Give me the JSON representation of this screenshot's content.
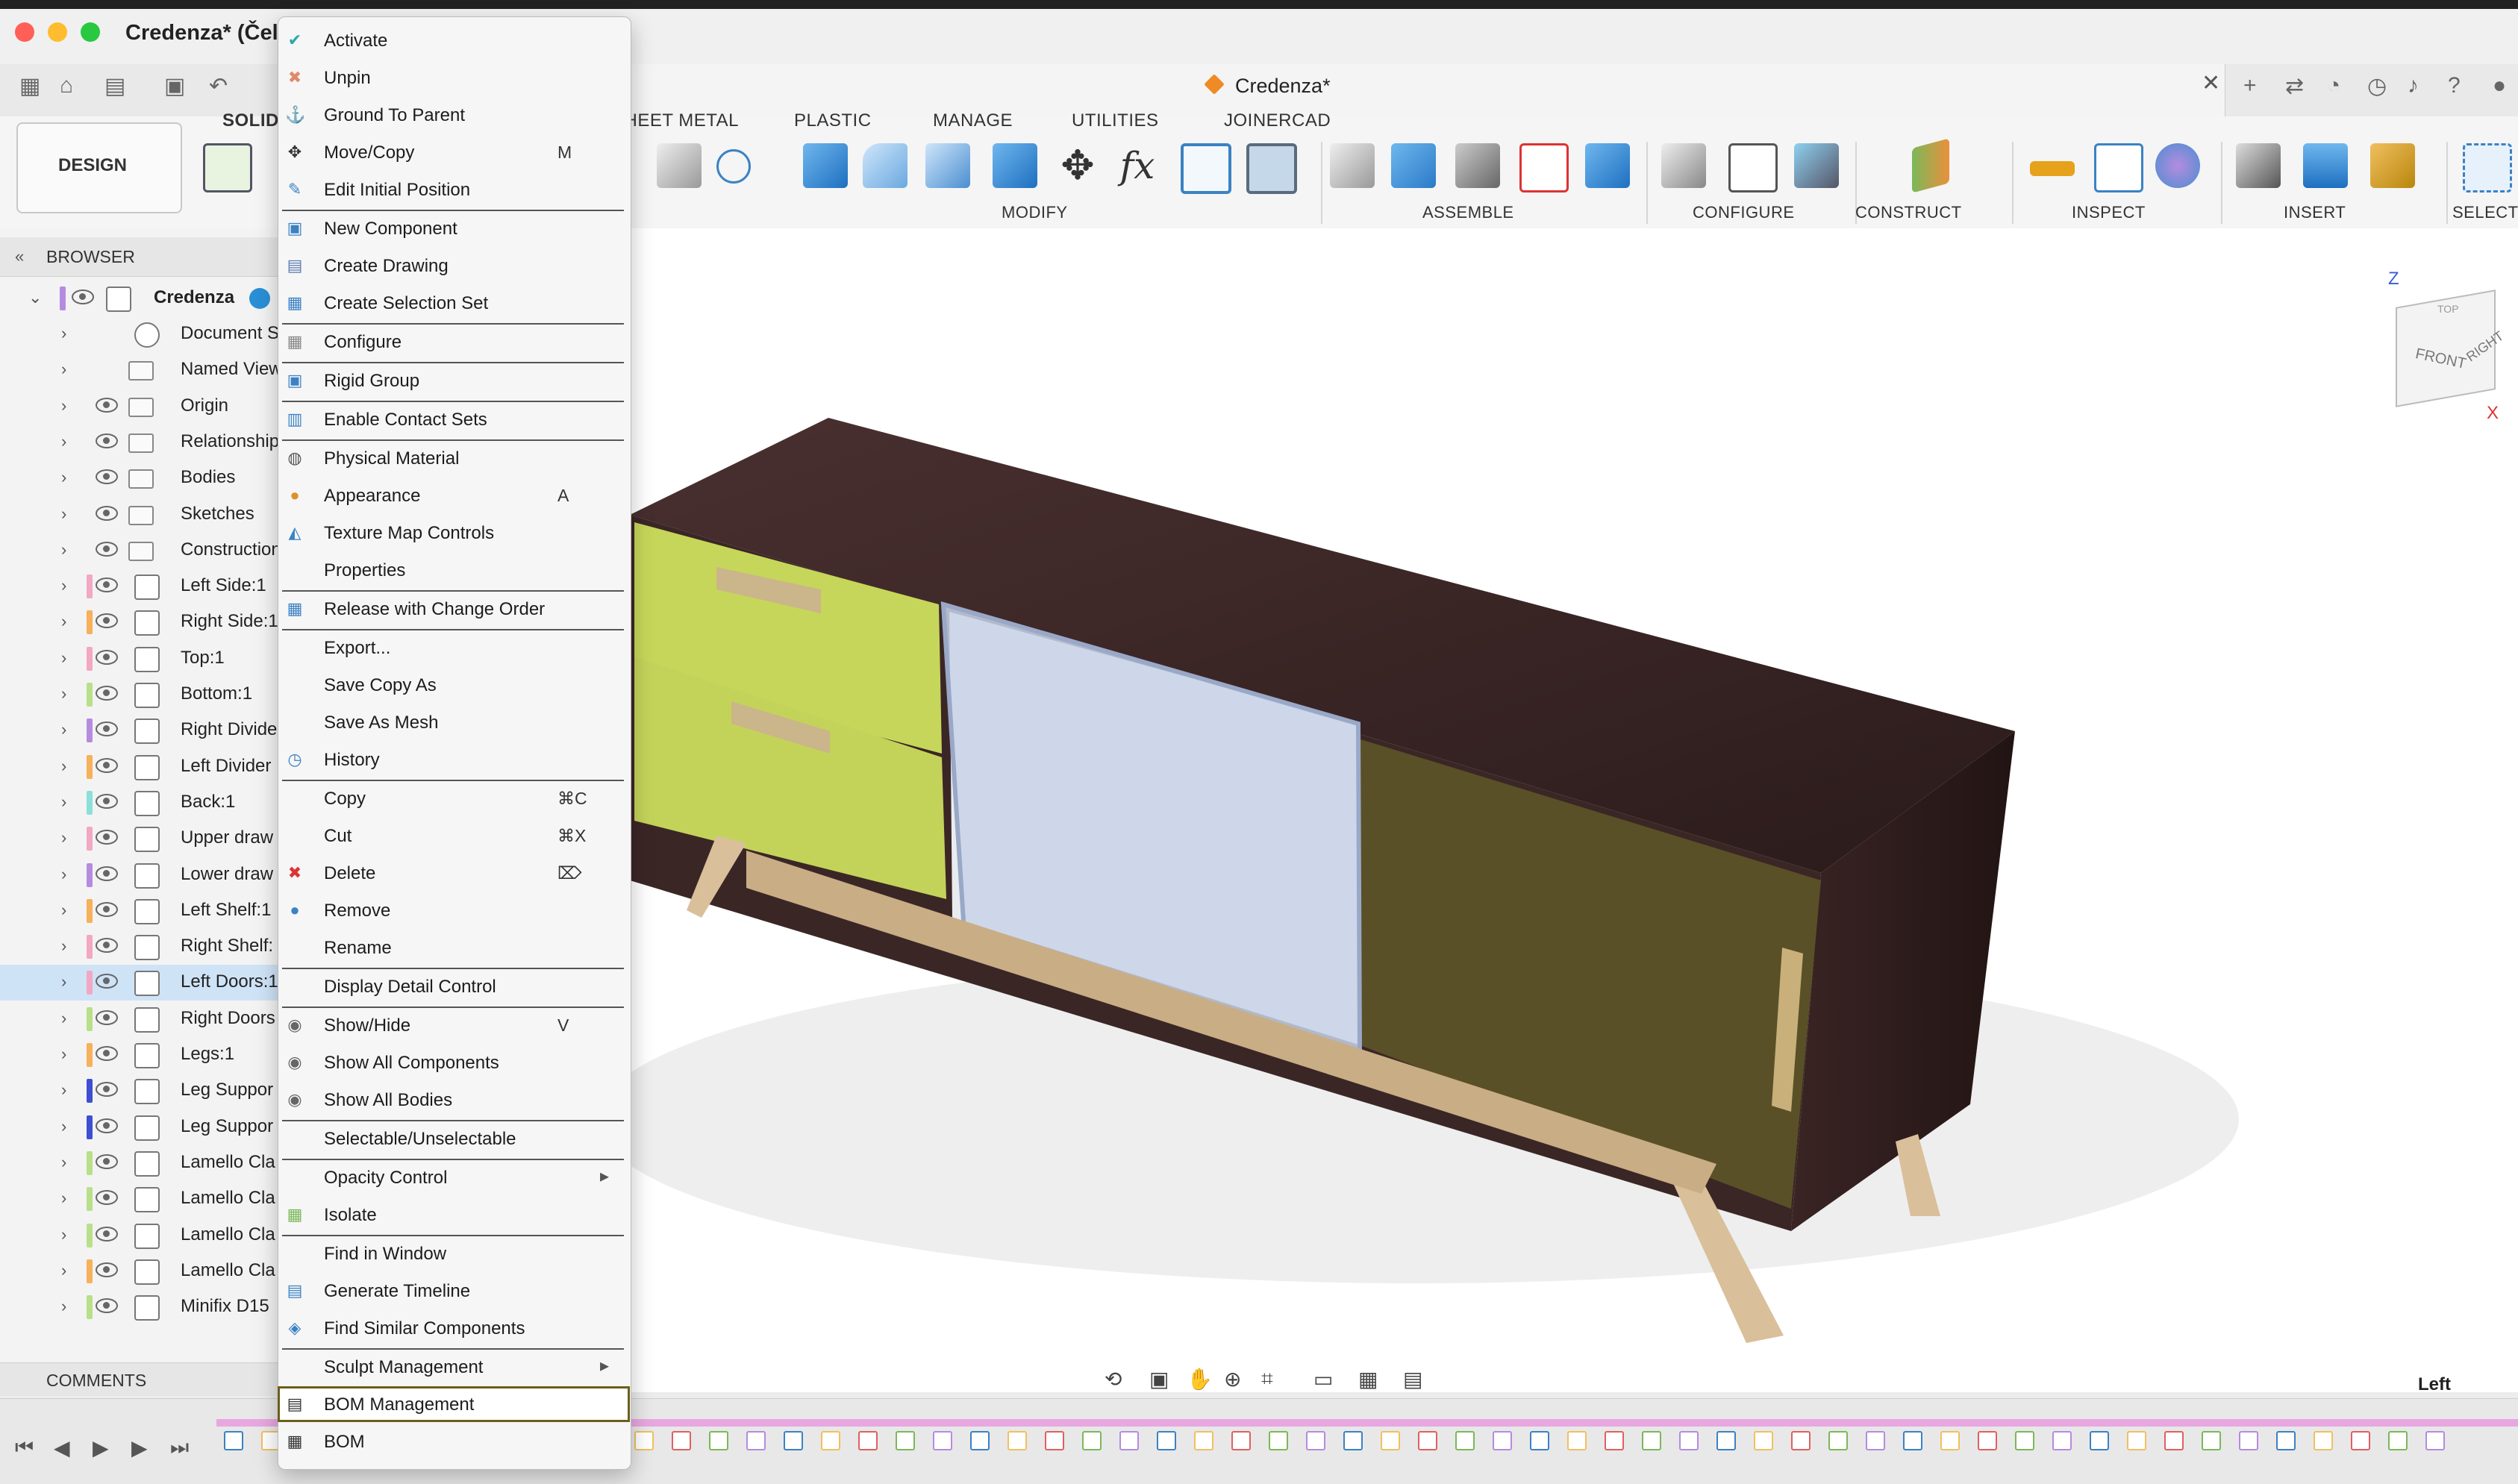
{
  "window": {
    "title": "Credenza* (Čeli",
    "document_tab": "Credenza*"
  },
  "workspace": {
    "design_button": "DESIGN",
    "tabs": [
      "SOLID",
      "SHEET METAL",
      "PLASTIC",
      "MANAGE",
      "UTILITIES",
      "JOINERCAD"
    ],
    "groups": [
      "MODIFY",
      "ASSEMBLE",
      "CONFIGURE",
      "CONSTRUCT",
      "INSPECT",
      "INSERT",
      "SELECT"
    ]
  },
  "browser": {
    "title": "BROWSER",
    "root": "Credenza",
    "items": [
      {
        "label": "Document Settin",
        "kind": "gear",
        "color": ""
      },
      {
        "label": "Named Views",
        "kind": "folder",
        "color": ""
      },
      {
        "label": "Origin",
        "kind": "folder",
        "color": ""
      },
      {
        "label": "Relationship",
        "kind": "folder",
        "color": ""
      },
      {
        "label": "Bodies",
        "kind": "folder",
        "color": ""
      },
      {
        "label": "Sketches",
        "kind": "folder",
        "color": ""
      },
      {
        "label": "Construction",
        "kind": "folder",
        "color": ""
      },
      {
        "label": "Left Side:1",
        "kind": "comp",
        "color": "#f2a7c3"
      },
      {
        "label": "Right Side:1",
        "kind": "comp",
        "color": "#f6b15a"
      },
      {
        "label": "Top:1",
        "kind": "comp",
        "color": "#f2a7c3"
      },
      {
        "label": "Bottom:1",
        "kind": "comp",
        "color": "#b8e08b"
      },
      {
        "label": "Right Divide",
        "kind": "comp",
        "color": "#b58be0"
      },
      {
        "label": "Left Divider",
        "kind": "comp",
        "color": "#f6b15a"
      },
      {
        "label": "Back:1",
        "kind": "comp",
        "color": "#8be0d9"
      },
      {
        "label": "Upper draw",
        "kind": "comp",
        "color": "#f2a7c3"
      },
      {
        "label": "Lower draw",
        "kind": "comp",
        "color": "#b58be0"
      },
      {
        "label": "Left Shelf:1",
        "kind": "comp",
        "color": "#f6b15a"
      },
      {
        "label": "Right Shelf:",
        "kind": "comp",
        "color": "#f2a7c3"
      },
      {
        "label": "Left Doors:1",
        "kind": "comp",
        "color": "#f2a7c3",
        "selected": true
      },
      {
        "label": "Right Doors",
        "kind": "comp",
        "color": "#b8e08b"
      },
      {
        "label": "Legs:1",
        "kind": "comp",
        "color": "#f6b15a"
      },
      {
        "label": "Leg Suppor",
        "kind": "comp",
        "color": "#3e4fd1"
      },
      {
        "label": "Leg Suppor",
        "kind": "comp",
        "color": "#3e4fd1"
      },
      {
        "label": "Lamello Cla",
        "kind": "assy",
        "color": "#b8e08b"
      },
      {
        "label": "Lamello Cla",
        "kind": "assy",
        "color": "#b8e08b"
      },
      {
        "label": "Lamello Cla",
        "kind": "assy",
        "color": "#b8e08b"
      },
      {
        "label": "Lamello Cla",
        "kind": "assy",
        "color": "#f6b15a"
      },
      {
        "label": "Minifix D15",
        "kind": "assy",
        "color": "#b8e08b"
      }
    ],
    "comments": "COMMENTS"
  },
  "context_menu": {
    "items": [
      {
        "label": "Activate",
        "icon": "check-circle-icon",
        "shortcut": ""
      },
      {
        "label": "Unpin",
        "icon": "unpin-icon",
        "shortcut": ""
      },
      {
        "label": "Ground To Parent",
        "icon": "anchor-icon",
        "shortcut": ""
      },
      {
        "label": "Move/Copy",
        "icon": "move-icon",
        "shortcut": "M"
      },
      {
        "label": "Edit Initial Position",
        "icon": "edit-position-icon",
        "shortcut": "",
        "sep_after": true
      },
      {
        "label": "New Component",
        "icon": "new-component-icon",
        "shortcut": ""
      },
      {
        "label": "Create Drawing",
        "icon": "drawing-icon",
        "shortcut": ""
      },
      {
        "label": "Create Selection Set",
        "icon": "selection-set-icon",
        "shortcut": "",
        "sep_after": true
      },
      {
        "label": "Configure",
        "icon": "configure-icon",
        "shortcut": "",
        "sep_after": true
      },
      {
        "label": "Rigid Group",
        "icon": "rigid-group-icon",
        "shortcut": "",
        "sep_after": true
      },
      {
        "label": "Enable Contact Sets",
        "icon": "contact-sets-icon",
        "shortcut": "",
        "sep_after": true
      },
      {
        "label": "Physical Material",
        "icon": "material-icon",
        "shortcut": ""
      },
      {
        "label": "Appearance",
        "icon": "appearance-icon",
        "shortcut": "A"
      },
      {
        "label": "Texture Map Controls",
        "icon": "texture-icon",
        "shortcut": ""
      },
      {
        "label": "Properties",
        "icon": "",
        "shortcut": "",
        "sep_after": true
      },
      {
        "label": "Release with Change Order",
        "icon": "release-icon",
        "shortcut": "",
        "sep_after": true
      },
      {
        "label": "Export...",
        "icon": "",
        "shortcut": ""
      },
      {
        "label": "Save Copy As",
        "icon": "",
        "shortcut": ""
      },
      {
        "label": "Save As Mesh",
        "icon": "",
        "shortcut": ""
      },
      {
        "label": "History",
        "icon": "history-icon",
        "shortcut": "",
        "sep_after": true
      },
      {
        "label": "Copy",
        "icon": "",
        "shortcut": "⌘C"
      },
      {
        "label": "Cut",
        "icon": "",
        "shortcut": "⌘X"
      },
      {
        "label": "Delete",
        "icon": "delete-icon",
        "shortcut": "⌦"
      },
      {
        "label": "Remove",
        "icon": "remove-icon",
        "shortcut": ""
      },
      {
        "label": "Rename",
        "icon": "",
        "shortcut": "",
        "sep_after": true
      },
      {
        "label": "Display Detail Control",
        "icon": "",
        "shortcut": "",
        "sep_after": true
      },
      {
        "label": "Show/Hide",
        "icon": "eye-icon",
        "shortcut": "V"
      },
      {
        "label": "Show All Components",
        "icon": "eye-icon",
        "shortcut": ""
      },
      {
        "label": "Show All Bodies",
        "icon": "eye-icon",
        "shortcut": "",
        "sep_after": true
      },
      {
        "label": "Selectable/Unselectable",
        "icon": "",
        "shortcut": "",
        "sep_after": true
      },
      {
        "label": "Opacity Control",
        "icon": "",
        "shortcut": "",
        "submenu": true
      },
      {
        "label": "Isolate",
        "icon": "isolate-icon",
        "shortcut": "",
        "sep_after": true
      },
      {
        "label": "Find in Window",
        "icon": "",
        "shortcut": ""
      },
      {
        "label": "Generate Timeline",
        "icon": "timeline-icon",
        "shortcut": ""
      },
      {
        "label": "Find Similar Components",
        "icon": "find-similar-icon",
        "shortcut": "",
        "sep_after": true
      },
      {
        "label": "Sculpt Management",
        "icon": "",
        "shortcut": "",
        "submenu": true
      },
      {
        "label": "BOM Management",
        "icon": "bom-management-icon",
        "shortcut": "",
        "highlighted": true
      },
      {
        "label": "BOM",
        "icon": "bom-icon",
        "shortcut": ""
      }
    ]
  },
  "status": {
    "selection": "Left Doors:1"
  },
  "viewcube": {
    "top": "TOP",
    "front": "FRONT",
    "right": "RIGHT",
    "z": "Z",
    "x": "X"
  }
}
